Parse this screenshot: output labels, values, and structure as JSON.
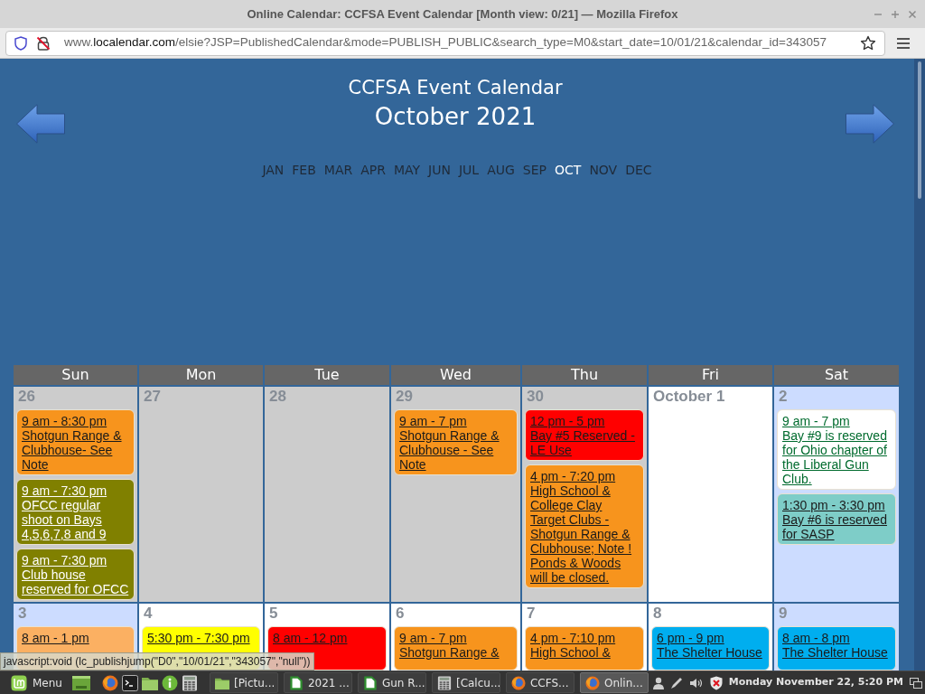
{
  "window": {
    "title": "Online Calendar: CCFSA Event Calendar [Month view: 0/21] — Mozilla Firefox"
  },
  "toolbar": {
    "url": {
      "prefix": "www.",
      "domain": "localendar.com",
      "path": "/elsie?JSP=PublishedCalendar&mode=PUBLISH_PUBLIC&search_type=M0&start_date=10/01/21&calendar_id=343057"
    }
  },
  "calendar": {
    "title": "CCFSA Event Calendar",
    "month": "October 2021",
    "months": [
      {
        "label": "JAN",
        "selected": false
      },
      {
        "label": "FEB",
        "selected": false
      },
      {
        "label": "MAR",
        "selected": false
      },
      {
        "label": "APR",
        "selected": false
      },
      {
        "label": "MAY",
        "selected": false
      },
      {
        "label": "JUN",
        "selected": false
      },
      {
        "label": "JUL",
        "selected": false
      },
      {
        "label": "AUG",
        "selected": false
      },
      {
        "label": "SEP",
        "selected": false
      },
      {
        "label": "OCT",
        "selected": true
      },
      {
        "label": "NOV",
        "selected": false
      },
      {
        "label": "DEC",
        "selected": false
      }
    ],
    "weekdays": [
      "Sun",
      "Mon",
      "Tue",
      "Wed",
      "Thu",
      "Fri",
      "Sat"
    ],
    "weeks": [
      [
        {
          "label": "26",
          "kind": "outside",
          "events": [
            {
              "time": "9 am - 8:30 pm",
              "title": "Shotgun Range & Clubhouse- See Note",
              "color": "#f7941d",
              "kind": "dark_text"
            },
            {
              "time": "9 am - 7:30 pm",
              "title": "OFCC regular shoot on Bays 4,5,6,7,8 and 9",
              "color": "#808000",
              "kind": "light_text"
            },
            {
              "time": "9 am - 7:30 pm",
              "title": "Club house reserved for OFCC",
              "color": "#808000",
              "kind": "light_text"
            }
          ]
        },
        {
          "label": "27",
          "kind": "outside"
        },
        {
          "label": "28",
          "kind": "outside"
        },
        {
          "label": "29",
          "kind": "outside",
          "events": [
            {
              "time": "9 am - 7 pm",
              "title": "Shotgun Range & Clubhouse - See Note",
              "color": "#f7941d",
              "kind": "dark_text"
            }
          ]
        },
        {
          "label": "30",
          "kind": "outside",
          "events": [
            {
              "time": "12 pm - 5 pm",
              "title": "Bay #5 Reserved - LE Use",
              "color": "#ff0000",
              "kind": "dark_text"
            },
            {
              "time": "4 pm - 7:20 pm",
              "title": "High School & College Clay Target Clubs - Shotgun Range & Clubhouse; Note ! Ponds & Woods will be closed.",
              "color": "#f7941d",
              "kind": "dark_text"
            }
          ]
        },
        {
          "label": "October 1",
          "kind": "weekday"
        },
        {
          "label": "2",
          "kind": "weekend",
          "events": [
            {
              "time": "9 am - 7 pm",
              "title": "Bay #9 is reserved for Ohio chapter of the Liberal Gun Club.",
              "color": "#ffffff",
              "kind": "green_text"
            },
            {
              "time": "1:30 pm - 3:30 pm",
              "title": "Bay #6 is reserved for SASP",
              "color": "#7ecdc8",
              "kind": "dark_text"
            }
          ]
        }
      ],
      [
        {
          "label": "3",
          "kind": "weekend",
          "events": [
            {
              "time": "8 am - 1 pm",
              "color": "#fbb062",
              "kind": "dark_text"
            }
          ]
        },
        {
          "label": "4",
          "kind": "weekday",
          "events": [
            {
              "time": "5:30 pm - 7:30 pm",
              "color": "#ffff00",
              "kind": "dark_text"
            }
          ]
        },
        {
          "label": "5",
          "kind": "weekday",
          "events": [
            {
              "time": "8 am - 12 pm",
              "color": "#ff0000",
              "kind": "dark_text"
            }
          ]
        },
        {
          "label": "6",
          "kind": "weekday",
          "events": [
            {
              "time": "9 am - 7 pm",
              "title": "Shotgun Range &",
              "color": "#f7941d",
              "kind": "dark_text"
            }
          ]
        },
        {
          "label": "7",
          "kind": "weekday",
          "events": [
            {
              "time": "4 pm - 7:10 pm",
              "title": "High School &",
              "color": "#f7941d",
              "kind": "dark_text"
            }
          ]
        },
        {
          "label": "8",
          "kind": "weekday",
          "events": [
            {
              "time": "6 pm - 9 pm",
              "title": "The Shelter House",
              "color": "#00aeef",
              "kind": "dark_text"
            }
          ]
        },
        {
          "label": "9",
          "kind": "weekend",
          "events": [
            {
              "time": "8 am - 8 pm",
              "title": "The Shelter House",
              "color": "#00aeef",
              "kind": "dark_text"
            }
          ]
        }
      ]
    ]
  },
  "status_text": "javascript:void (lc_publishjump(\"D0\",\"10/01/21\",\"343057\",\"null\"))",
  "taskbar": {
    "menu_label": "Menu",
    "windows": [
      {
        "label": "[Pictu...",
        "kind": "folder",
        "selected": false
      },
      {
        "label": "2021 ...",
        "kind": "document",
        "selected": false
      },
      {
        "label": "Gun R...",
        "kind": "document",
        "selected": false
      },
      {
        "label": "[Calcu...",
        "kind": "calculator",
        "selected": false
      },
      {
        "label": "CCFS...",
        "kind": "browser",
        "selected": false
      },
      {
        "label": "Onlin...",
        "kind": "browser",
        "selected": true
      }
    ],
    "clock": "Monday November 22, 5:20 PM"
  }
}
